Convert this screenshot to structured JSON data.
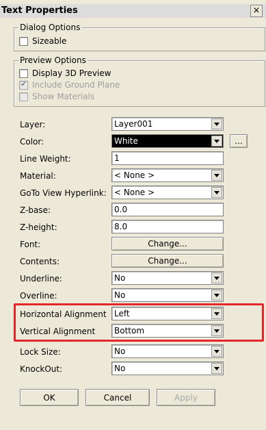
{
  "dialog": {
    "title": "Text Properties",
    "close_glyph": "×"
  },
  "dialog_options": {
    "legend": "Dialog Options",
    "sizeable": {
      "label": "Sizeable",
      "checked": false
    }
  },
  "preview_options": {
    "legend": "Preview Options",
    "display_3d": {
      "label": "Display 3D Preview",
      "checked": false
    },
    "include_ground": {
      "label": "Include Ground Plane",
      "checked": true,
      "disabled": true
    },
    "show_materials": {
      "label": "Show Materials",
      "checked": false,
      "disabled": true
    }
  },
  "properties": {
    "layer": {
      "label": "Layer:",
      "value": "Layer001"
    },
    "color": {
      "label": "Color:",
      "value": "White",
      "more": "..."
    },
    "line_weight": {
      "label": "Line Weight:",
      "value": "1"
    },
    "material": {
      "label": "Material:",
      "value": "< None >"
    },
    "goto_view": {
      "label": "GoTo View Hyperlink:",
      "value": "< None >"
    },
    "z_base": {
      "label": "Z-base:",
      "value": "0.0"
    },
    "z_height": {
      "label": "Z-height:",
      "value": "8.0"
    },
    "font": {
      "label": "Font:",
      "button": "Change..."
    },
    "contents": {
      "label": "Contents:",
      "button": "Change..."
    },
    "underline": {
      "label": "Underline:",
      "value": "No"
    },
    "overline": {
      "label": "Overline:",
      "value": "No"
    },
    "horizontal_alignment": {
      "label": "Horizontal Alignment",
      "value": "Left"
    },
    "vertical_alignment": {
      "label": "Vertical Alignment",
      "value": "Bottom"
    },
    "lock_size": {
      "label": "Lock Size:",
      "value": "No"
    },
    "knockout": {
      "label": "KnockOut:",
      "value": "No"
    }
  },
  "buttons": {
    "ok": "OK",
    "cancel": "Cancel",
    "apply": "Apply"
  },
  "colors": {
    "highlight": "#e3262a",
    "panel": "#ece9d8",
    "selected_color_bg": "#000000"
  }
}
